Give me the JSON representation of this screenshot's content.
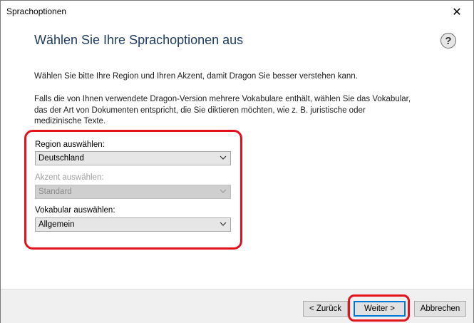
{
  "window": {
    "title": "Sprachoptionen",
    "close_glyph": "✕"
  },
  "header": {
    "title": "Wählen Sie Ihre Sprachoptionen aus",
    "help_glyph": "?"
  },
  "intro": {
    "paragraph1": "Wählen Sie bitte Ihre Region und Ihren Akzent, damit Dragon Sie besser verstehen kann.",
    "paragraph2": "Falls die von Ihnen verwendete Dragon-Version mehrere Vokabulare enthält, wählen Sie das Vokabular, das der Art von Dokumenten entspricht, die Sie diktieren möchten, wie z. B. juristische oder medizinische Texte."
  },
  "form": {
    "region": {
      "label": "Region auswählen:",
      "value": "Deutschland",
      "enabled": true
    },
    "accent": {
      "label": "Akzent auswählen:",
      "value": "Standard",
      "enabled": false
    },
    "vocabulary": {
      "label": "Vokabular auswählen:",
      "value": "Allgemein",
      "enabled": true
    }
  },
  "buttons": {
    "back": "< Zurück",
    "next": "Weiter >",
    "cancel": "Abbrechen"
  },
  "colors": {
    "highlight": "#e3111b",
    "primary_border": "#0078d7"
  }
}
